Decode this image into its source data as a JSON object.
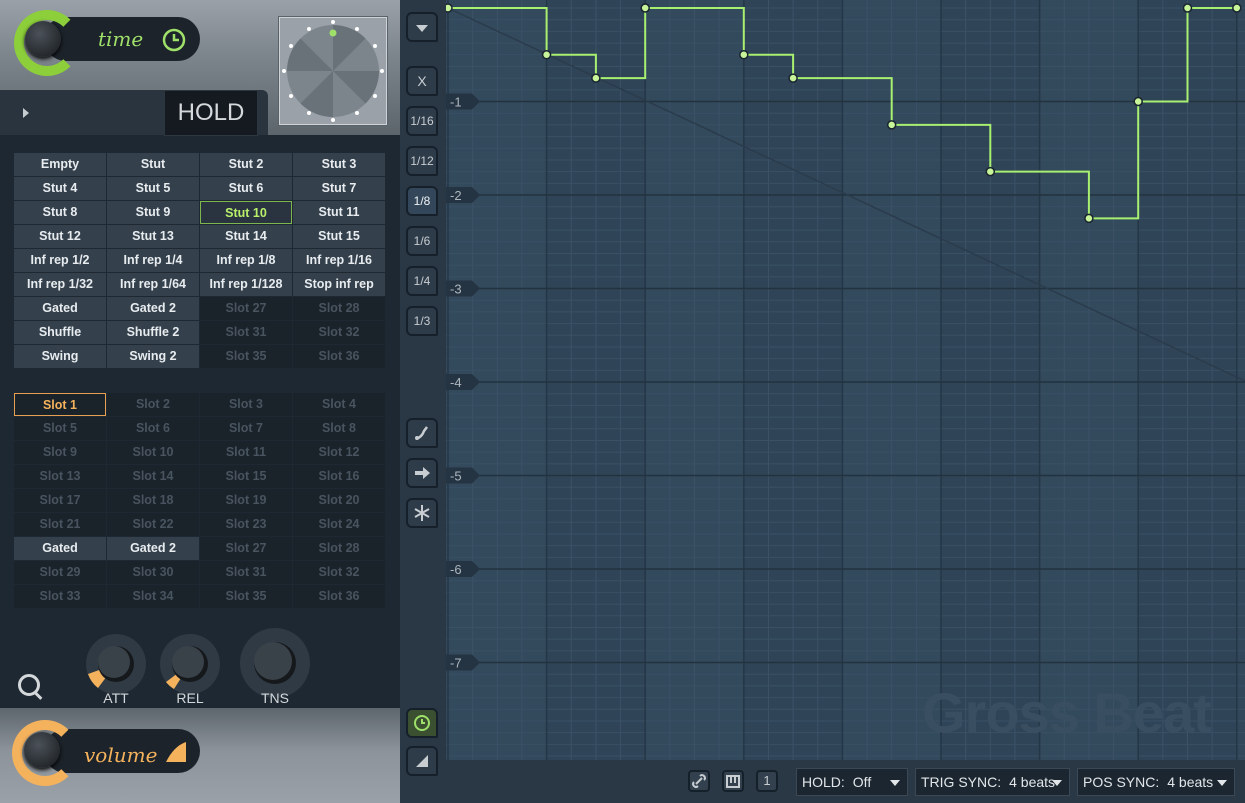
{
  "time": {
    "label": "time"
  },
  "hold": {
    "label": "HOLD"
  },
  "time_presets": [
    "Empty",
    "Stut",
    "Stut 2",
    "Stut 3",
    "Stut 4",
    "Stut 5",
    "Stut 6",
    "Stut 7",
    "Stut 8",
    "Stut 9",
    "Stut 10",
    "Stut 11",
    "Stut 12",
    "Stut 13",
    "Stut 14",
    "Stut 15",
    "Inf rep 1/2",
    "Inf rep 1/4",
    "Inf rep 1/8",
    "Inf rep 1/16",
    "Inf rep 1/32",
    "Inf rep 1/64",
    "Inf rep 1/128",
    "Stop inf rep",
    "Gated",
    "Gated 2",
    "Slot 27",
    "Slot 28",
    "Shuffle",
    "Shuffle 2",
    "Slot 31",
    "Slot 32",
    "Swing",
    "Swing 2",
    "Slot 35",
    "Slot 36"
  ],
  "time_selected_index": 10,
  "volume_presets": [
    "Slot 1",
    "Slot 2",
    "Slot 3",
    "Slot 4",
    "Slot 5",
    "Slot 6",
    "Slot 7",
    "Slot 8",
    "Slot 9",
    "Slot 10",
    "Slot 11",
    "Slot 12",
    "Slot 13",
    "Slot 14",
    "Slot 15",
    "Slot 16",
    "Slot 17",
    "Slot 18",
    "Slot 19",
    "Slot 20",
    "Slot 21",
    "Slot 22",
    "Slot 23",
    "Slot 24",
    "Gated",
    "Gated 2",
    "Slot 27",
    "Slot 28",
    "Slot 29",
    "Slot 30",
    "Slot 31",
    "Slot 32",
    "Slot 33",
    "Slot 34",
    "Slot 35",
    "Slot 36"
  ],
  "volume_selected_index": 0,
  "knobs": {
    "att": "ATT",
    "rel": "REL",
    "tns": "TNS"
  },
  "volume": {
    "label": "volume"
  },
  "sidebar": {
    "x": "X",
    "div16": "1/16",
    "div12": "1/12",
    "div8": "1/8",
    "div6": "1/6",
    "div4": "1/4",
    "div3": "1/3"
  },
  "y_labels": [
    "-1",
    "-2",
    "-3",
    "-4",
    "-5",
    "-6",
    "-7"
  ],
  "envelope_points": [
    {
      "beat": 0,
      "value": 0
    },
    {
      "beat": 1,
      "value": 0
    },
    {
      "beat": 1,
      "value": -0.5
    },
    {
      "beat": 1.5,
      "value": -0.5
    },
    {
      "beat": 1.5,
      "value": -0.75
    },
    {
      "beat": 2,
      "value": -0.75
    },
    {
      "beat": 2,
      "value": 0
    },
    {
      "beat": 3,
      "value": 0
    },
    {
      "beat": 3,
      "value": -0.5
    },
    {
      "beat": 3.5,
      "value": -0.5
    },
    {
      "beat": 3.5,
      "value": -0.75
    },
    {
      "beat": 4.5,
      "value": -0.75
    },
    {
      "beat": 4.5,
      "value": -1.25
    },
    {
      "beat": 5.5,
      "value": -1.25
    },
    {
      "beat": 5.5,
      "value": -1.75
    },
    {
      "beat": 6.5,
      "value": -1.75
    },
    {
      "beat": 6.5,
      "value": -2.25
    },
    {
      "beat": 7,
      "value": -2.25
    },
    {
      "beat": 7,
      "value": -1
    },
    {
      "beat": 7.5,
      "value": -1
    },
    {
      "beat": 7.5,
      "value": 0
    },
    {
      "beat": 8,
      "value": 0
    }
  ],
  "control_point_indices": [
    0,
    2,
    4,
    6,
    8,
    10,
    12,
    14,
    16,
    18,
    20,
    21
  ],
  "envelope_color": "#a8f070",
  "bottom": {
    "hold_label": "HOLD:",
    "hold_value": "Off",
    "trig_label": "TRIG SYNC:",
    "trig_value": "4 beats",
    "pos_label": "POS SYNC:",
    "pos_value": "4 beats",
    "one_label": "1"
  },
  "watermark": "Gross Beat"
}
